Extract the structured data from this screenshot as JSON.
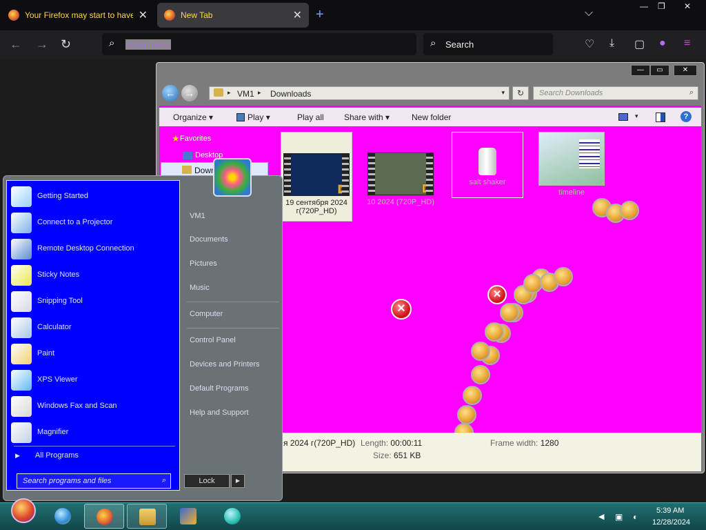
{
  "firefox": {
    "tabs": [
      {
        "title": "Your Firefox may start to have p",
        "close": "✕"
      },
      {
        "title": "New Tab",
        "close": "✕"
      }
    ],
    "new_tab": "+",
    "tab_list": "⌵",
    "window_controls": {
      "minimize": "—",
      "restore": "❐",
      "close": "✕"
    },
    "nav": {
      "back": "←",
      "forward": "→",
      "reload": "↻"
    },
    "urlbar": {
      "value": "about:newt",
      "icon": "search-icon"
    },
    "search": {
      "placeholder": "Search",
      "icon": "search-icon"
    },
    "toolbar_icons": [
      "pocket-icon",
      "download-icon",
      "extension-icon",
      "account-icon",
      "menu-icon"
    ]
  },
  "explorer": {
    "window_controls": {
      "minimize": "—",
      "maximize": "▭",
      "close": "✕"
    },
    "address": {
      "root": "VM1",
      "folder": "Downloads",
      "separator": "▸",
      "dropdown": "▾"
    },
    "refresh": "↻",
    "search_placeholder": "Search Downloads",
    "search_icon": "⌕",
    "commands": {
      "organize": "Organize",
      "play": "Play",
      "play_all": "Play all",
      "share_with": "Share with",
      "new_folder": "New folder",
      "dropdown": "▾",
      "help": "?"
    },
    "nav_pane": {
      "favorites": "Favorites",
      "desktop": "Desktop",
      "downloads": "Downloads"
    },
    "files": [
      {
        "name": "19 сентября 2024 г(720P_HD)",
        "type": "video"
      },
      {
        "name": "10 2024 (720P_HD)",
        "type": "video"
      },
      {
        "name": "salt shaker",
        "type": "file"
      },
      {
        "name": "timeline",
        "type": "document"
      }
    ],
    "details": {
      "name": "я 2024 г(720P_HD)",
      "length_label": "Length:",
      "length": "00:00:11",
      "size_label": "Size:",
      "size": "651 KB",
      "frame_width_label": "Frame width:",
      "frame_width": "1280"
    },
    "error_mark": "✕"
  },
  "start_menu": {
    "programs": [
      {
        "label": "Getting Started",
        "icon": "getting-started-icon",
        "color": "#9ad0ff"
      },
      {
        "label": "Connect to a Projector",
        "icon": "projector-icon",
        "color": "#7ab0e8"
      },
      {
        "label": "Remote Desktop Connection",
        "icon": "remote-desktop-icon",
        "color": "#5a8ad0"
      },
      {
        "label": "Sticky Notes",
        "icon": "sticky-notes-icon",
        "color": "#e8e840"
      },
      {
        "label": "Snipping Tool",
        "icon": "snipping-tool-icon",
        "color": "#d8d8e8"
      },
      {
        "label": "Calculator",
        "icon": "calculator-icon",
        "color": "#a8c8e8"
      },
      {
        "label": "Paint",
        "icon": "paint-icon",
        "color": "#f0d070"
      },
      {
        "label": "XPS Viewer",
        "icon": "xps-viewer-icon",
        "color": "#60b8f0"
      },
      {
        "label": "Windows Fax and Scan",
        "icon": "fax-scan-icon",
        "color": "#d8d8d8"
      },
      {
        "label": "Magnifier",
        "icon": "magnifier-icon",
        "color": "#c0d0e0"
      }
    ],
    "all_programs": "All Programs",
    "all_programs_arrow": "▶",
    "search_placeholder": "Search programs and files",
    "search_icon": "⌕",
    "places": [
      "VM1",
      "Documents",
      "Pictures",
      "Music",
      "Computer",
      "Control Panel",
      "Devices and Printers",
      "Default Programs",
      "Help and Support"
    ],
    "shutdown_label": "Lock",
    "shutdown_arrow": "▶"
  },
  "taskbar": {
    "apps": [
      "start-orb",
      "internet-explorer-icon",
      "firefox-icon",
      "windows-explorer-icon",
      "media-player-icon",
      "app-icon"
    ],
    "tray_arrow": "◀",
    "clock": {
      "time": "5:39 AM",
      "date": "12/28/2024"
    }
  }
}
